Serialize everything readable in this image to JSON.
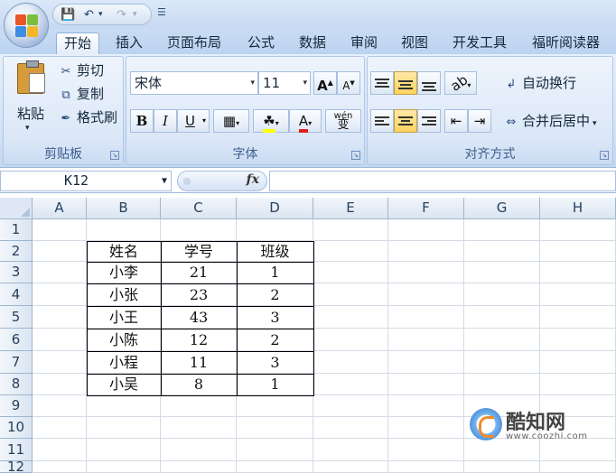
{
  "qat": {
    "save_icon": "save-icon",
    "undo_icon": "undo-icon",
    "redo_icon": "redo-icon"
  },
  "tabs": [
    "开始",
    "插入",
    "页面布局",
    "公式",
    "数据",
    "审阅",
    "视图",
    "开发工具",
    "福昕阅读器"
  ],
  "clipboard": {
    "paste": "粘贴",
    "cut": "剪切",
    "copy": "复制",
    "format_painter": "格式刷",
    "label": "剪贴板"
  },
  "font": {
    "name": "宋体",
    "size": "11",
    "bold": "B",
    "italic": "I",
    "underline": "U",
    "font_color": "A",
    "wen": "wén",
    "phonetic": "变",
    "grow": "A",
    "shrink": "A",
    "label": "字体"
  },
  "alignment": {
    "wrap_text": "自动换行",
    "merge_center": "合并后居中",
    "label": "对齐方式"
  },
  "formula_bar": {
    "name_box": "K12",
    "fx": "fx"
  },
  "columns": [
    "A",
    "B",
    "C",
    "D",
    "E",
    "F",
    "G",
    "H"
  ],
  "rows": [
    "1",
    "2",
    "3",
    "4",
    "5",
    "6",
    "7",
    "8",
    "9",
    "10",
    "11",
    "12"
  ],
  "table": {
    "headers": [
      "姓名",
      "学号",
      "班级"
    ],
    "data": [
      [
        "小李",
        "21",
        "1"
      ],
      [
        "小张",
        "23",
        "2"
      ],
      [
        "小王",
        "43",
        "3"
      ],
      [
        "小陈",
        "12",
        "2"
      ],
      [
        "小程",
        "11",
        "3"
      ],
      [
        "小吴",
        "8",
        "1"
      ]
    ]
  },
  "watermark": {
    "title": "酷知网",
    "url": "www.coozhi.com"
  },
  "colors": {
    "accent": "#ffd35d",
    "ribbon": "#d3e2f5",
    "grid_line": "#d4dbe5"
  }
}
